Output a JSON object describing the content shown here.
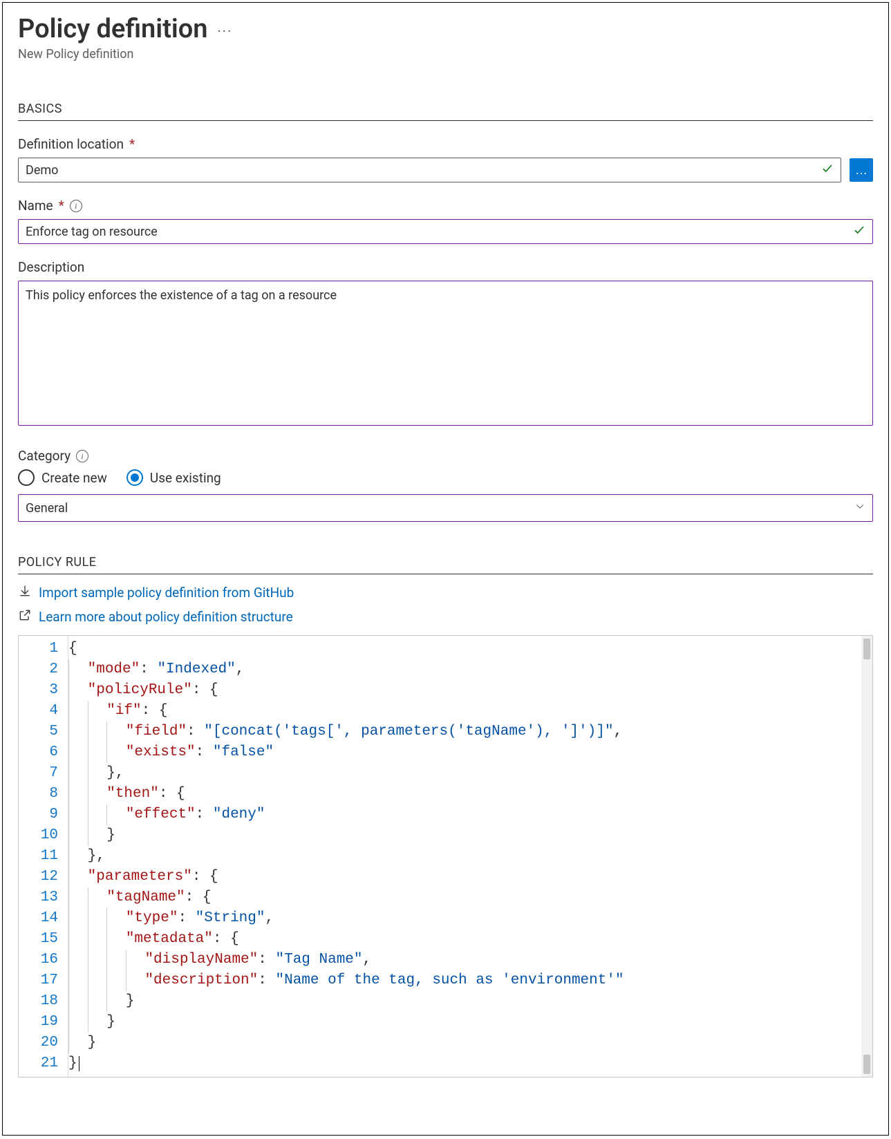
{
  "header": {
    "title": "Policy definition",
    "subtitle": "New Policy definition",
    "ellipsis": "···"
  },
  "sections": {
    "basics": "BASICS",
    "policy_rule": "POLICY RULE"
  },
  "fields": {
    "definition_location": {
      "label": "Definition location",
      "value": "Demo",
      "required": true
    },
    "name": {
      "label": "Name",
      "value": "Enforce tag on resource",
      "required": true
    },
    "description": {
      "label": "Description",
      "value": "This policy enforces the existence of a tag on a resource"
    },
    "category": {
      "label": "Category",
      "create_new": "Create new",
      "use_existing": "Use existing",
      "selected": "use_existing",
      "value": "General"
    }
  },
  "links": {
    "import_github": "Import sample policy definition from GitHub",
    "learn_more": "Learn more about policy definition structure"
  },
  "icons": {
    "ellipsis": "···",
    "info": "i"
  },
  "code": {
    "line_count": 21,
    "json_text": "{\n  \"mode\": \"Indexed\",\n  \"policyRule\": {\n    \"if\": {\n      \"field\": \"[concat('tags[', parameters('tagName'), ']')]\",\n      \"exists\": \"false\"\n    },\n    \"then\": {\n      \"effect\": \"deny\"\n    }\n  },\n  \"parameters\": {\n    \"tagName\": {\n      \"type\": \"String\",\n      \"metadata\": {\n        \"displayName\": \"Tag Name\",\n        \"description\": \"Name of the tag, such as 'environment'\"\n      }\n    }\n  }\n}",
    "tokens": [
      [
        [
          "pun",
          "{"
        ]
      ],
      [
        [
          "ind",
          1
        ],
        [
          "key",
          "\"mode\""
        ],
        [
          "pun",
          ": "
        ],
        [
          "strblue",
          "\"Indexed\""
        ],
        [
          "pun",
          ","
        ]
      ],
      [
        [
          "ind",
          1
        ],
        [
          "key",
          "\"policyRule\""
        ],
        [
          "pun",
          ": {"
        ]
      ],
      [
        [
          "ind",
          2
        ],
        [
          "key",
          "\"if\""
        ],
        [
          "pun",
          ": {"
        ]
      ],
      [
        [
          "ind",
          3
        ],
        [
          "key",
          "\"field\""
        ],
        [
          "pun",
          ": "
        ],
        [
          "strblue",
          "\"[concat('tags[', parameters('tagName'), ']')]\""
        ],
        [
          "pun",
          ","
        ]
      ],
      [
        [
          "ind",
          3
        ],
        [
          "key",
          "\"exists\""
        ],
        [
          "pun",
          ": "
        ],
        [
          "strblue",
          "\"false\""
        ]
      ],
      [
        [
          "ind",
          2
        ],
        [
          "pun",
          "},"
        ]
      ],
      [
        [
          "ind",
          2
        ],
        [
          "key",
          "\"then\""
        ],
        [
          "pun",
          ": {"
        ]
      ],
      [
        [
          "ind",
          3
        ],
        [
          "key",
          "\"effect\""
        ],
        [
          "pun",
          ": "
        ],
        [
          "strblue",
          "\"deny\""
        ]
      ],
      [
        [
          "ind",
          2
        ],
        [
          "pun",
          "}"
        ]
      ],
      [
        [
          "ind",
          1
        ],
        [
          "pun",
          "},"
        ]
      ],
      [
        [
          "ind",
          1
        ],
        [
          "key",
          "\"parameters\""
        ],
        [
          "pun",
          ": {"
        ]
      ],
      [
        [
          "ind",
          2
        ],
        [
          "key",
          "\"tagName\""
        ],
        [
          "pun",
          ": {"
        ]
      ],
      [
        [
          "ind",
          3
        ],
        [
          "key",
          "\"type\""
        ],
        [
          "pun",
          ": "
        ],
        [
          "strblue",
          "\"String\""
        ],
        [
          "pun",
          ","
        ]
      ],
      [
        [
          "ind",
          3
        ],
        [
          "key",
          "\"metadata\""
        ],
        [
          "pun",
          ": {"
        ]
      ],
      [
        [
          "ind",
          4
        ],
        [
          "key",
          "\"displayName\""
        ],
        [
          "pun",
          ": "
        ],
        [
          "strblue",
          "\"Tag Name\""
        ],
        [
          "pun",
          ","
        ]
      ],
      [
        [
          "ind",
          4
        ],
        [
          "key",
          "\"description\""
        ],
        [
          "pun",
          ": "
        ],
        [
          "strblue",
          "\"Name of the tag, such as 'environment'\""
        ]
      ],
      [
        [
          "ind",
          3
        ],
        [
          "pun",
          "}"
        ]
      ],
      [
        [
          "ind",
          2
        ],
        [
          "pun",
          "}"
        ]
      ],
      [
        [
          "ind",
          1
        ],
        [
          "pun",
          "}"
        ]
      ],
      [
        [
          "pun",
          "}"
        ],
        [
          "caret",
          ""
        ]
      ]
    ]
  }
}
